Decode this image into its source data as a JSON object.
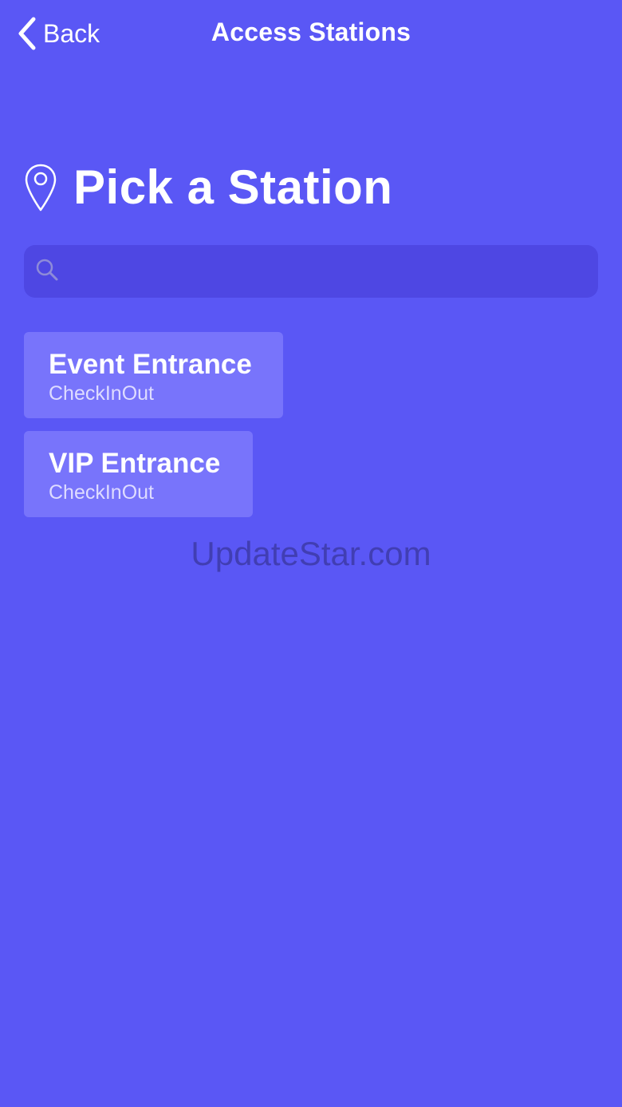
{
  "nav": {
    "back_label": "Back",
    "title": "Access Stations"
  },
  "heading": {
    "icon": "location-pin-icon",
    "text": "Pick a Station"
  },
  "search": {
    "icon": "search-icon",
    "value": "",
    "placeholder": ""
  },
  "stations": [
    {
      "name": "Event Entrance",
      "type": "CheckInOut"
    },
    {
      "name": "VIP Entrance",
      "type": "CheckInOut"
    }
  ],
  "watermark": "UpdateStar.com",
  "colors": {
    "background": "#5a57f5",
    "search_background": "#4e47e3",
    "card_background": "#7874fb",
    "text": "#ffffff"
  }
}
